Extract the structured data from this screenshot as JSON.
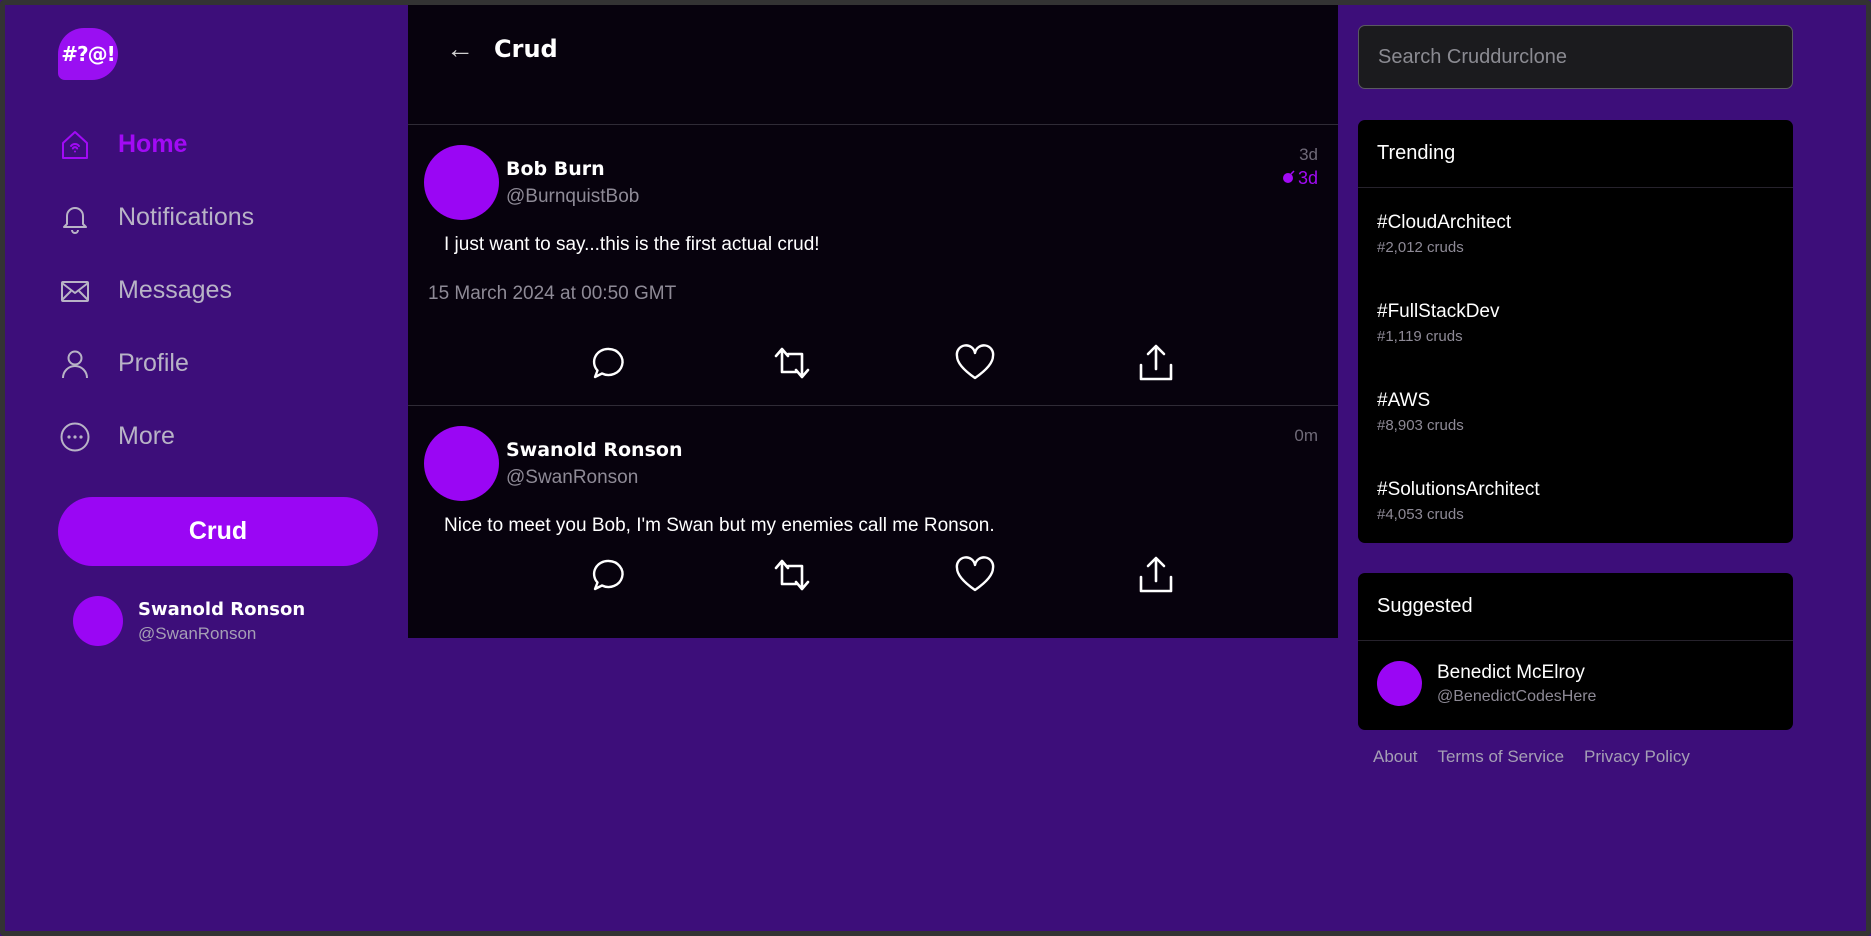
{
  "logo": {
    "text": "#?@!"
  },
  "sidebar": {
    "items": [
      {
        "label": "Home",
        "icon": "home-icon"
      },
      {
        "label": "Notifications",
        "icon": "bell-icon"
      },
      {
        "label": "Messages",
        "icon": "envelope-icon"
      },
      {
        "label": "Profile",
        "icon": "person-icon"
      },
      {
        "label": "More",
        "icon": "more-icon"
      }
    ],
    "crud_button": "Crud",
    "current_user": {
      "name": "Swanold Ronson",
      "handle": "@SwanRonson"
    }
  },
  "feed": {
    "back": "←",
    "title": "Crud",
    "posts": [
      {
        "name": "Bob Burn",
        "handle": "@BurnquistBob",
        "time": "3d",
        "edited_time": "3d",
        "text": "I just want to say...this is the first actual crud!",
        "date": "15 March 2024 at 00:50 GMT"
      },
      {
        "name": "Swanold Ronson",
        "handle": "@SwanRonson",
        "time": "0m",
        "text": "Nice to meet you Bob, I'm Swan but my enemies call me Ronson."
      }
    ]
  },
  "search": {
    "placeholder": "Search Cruddurclone"
  },
  "trending": {
    "title": "Trending",
    "items": [
      {
        "tag": "#CloudArchitect",
        "count": "#2,012 cruds"
      },
      {
        "tag": "#FullStackDev",
        "count": "#1,119 cruds"
      },
      {
        "tag": "#AWS",
        "count": "#8,903 cruds"
      },
      {
        "tag": "#SolutionsArchitect",
        "count": "#4,053 cruds"
      }
    ]
  },
  "suggested": {
    "title": "Suggested",
    "users": [
      {
        "name": "Benedict McElroy",
        "handle": "@BenedictCodesHere"
      }
    ]
  },
  "footer": {
    "links": [
      "About",
      "Terms of Service",
      "Privacy Policy"
    ]
  },
  "colors": {
    "background": "#3d0e7a",
    "accent": "#9a06f4",
    "feed": "#07020d"
  }
}
